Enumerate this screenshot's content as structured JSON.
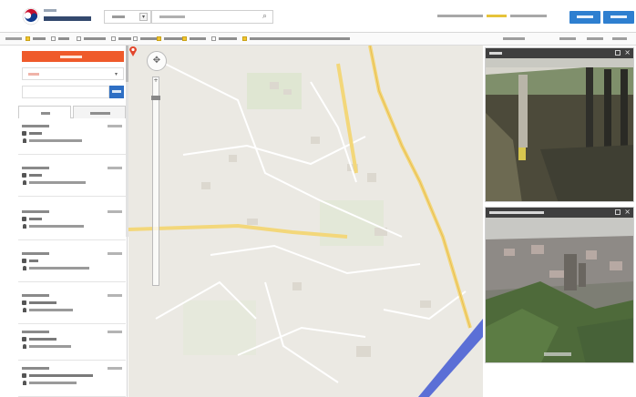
{
  "header": {
    "logo_icon": "government-taegeuk-logo",
    "agency_name": "",
    "region_select": "",
    "search_placeholder": "",
    "status_text": "",
    "button_left": "",
    "button_right": ""
  },
  "filters": [],
  "left_panel": {
    "report_button": "",
    "tabs": [
      "",
      ""
    ],
    "items": [
      {
        "time": "",
        "status": "",
        "type": "",
        "location": ""
      },
      {
        "time": "",
        "status": "",
        "type": "",
        "location": ""
      },
      {
        "time": "",
        "status": "",
        "type": "",
        "location": ""
      },
      {
        "time": "",
        "status": "",
        "type": "",
        "location": ""
      },
      {
        "time": "",
        "status": "",
        "type": "",
        "location": ""
      },
      {
        "time": "",
        "status": "",
        "type": "",
        "location": ""
      },
      {
        "time": "",
        "status": "",
        "type": "",
        "location": ""
      },
      {
        "time": "",
        "status": "",
        "type": "",
        "location": ""
      }
    ]
  },
  "map": {
    "marker_icon": "location-pin-icon",
    "colors": {
      "road_major": "#f3d77a",
      "river": "#5b6fd6",
      "park": "#d6e7c4"
    }
  },
  "cameras": [
    {
      "title": "",
      "scene": "river-bridge-cctv"
    },
    {
      "title": "",
      "scene": "city-aerial-cctv"
    }
  ],
  "colors": {
    "accent_red": "#ef5a2a",
    "accent_blue": "#2e7fd0"
  }
}
